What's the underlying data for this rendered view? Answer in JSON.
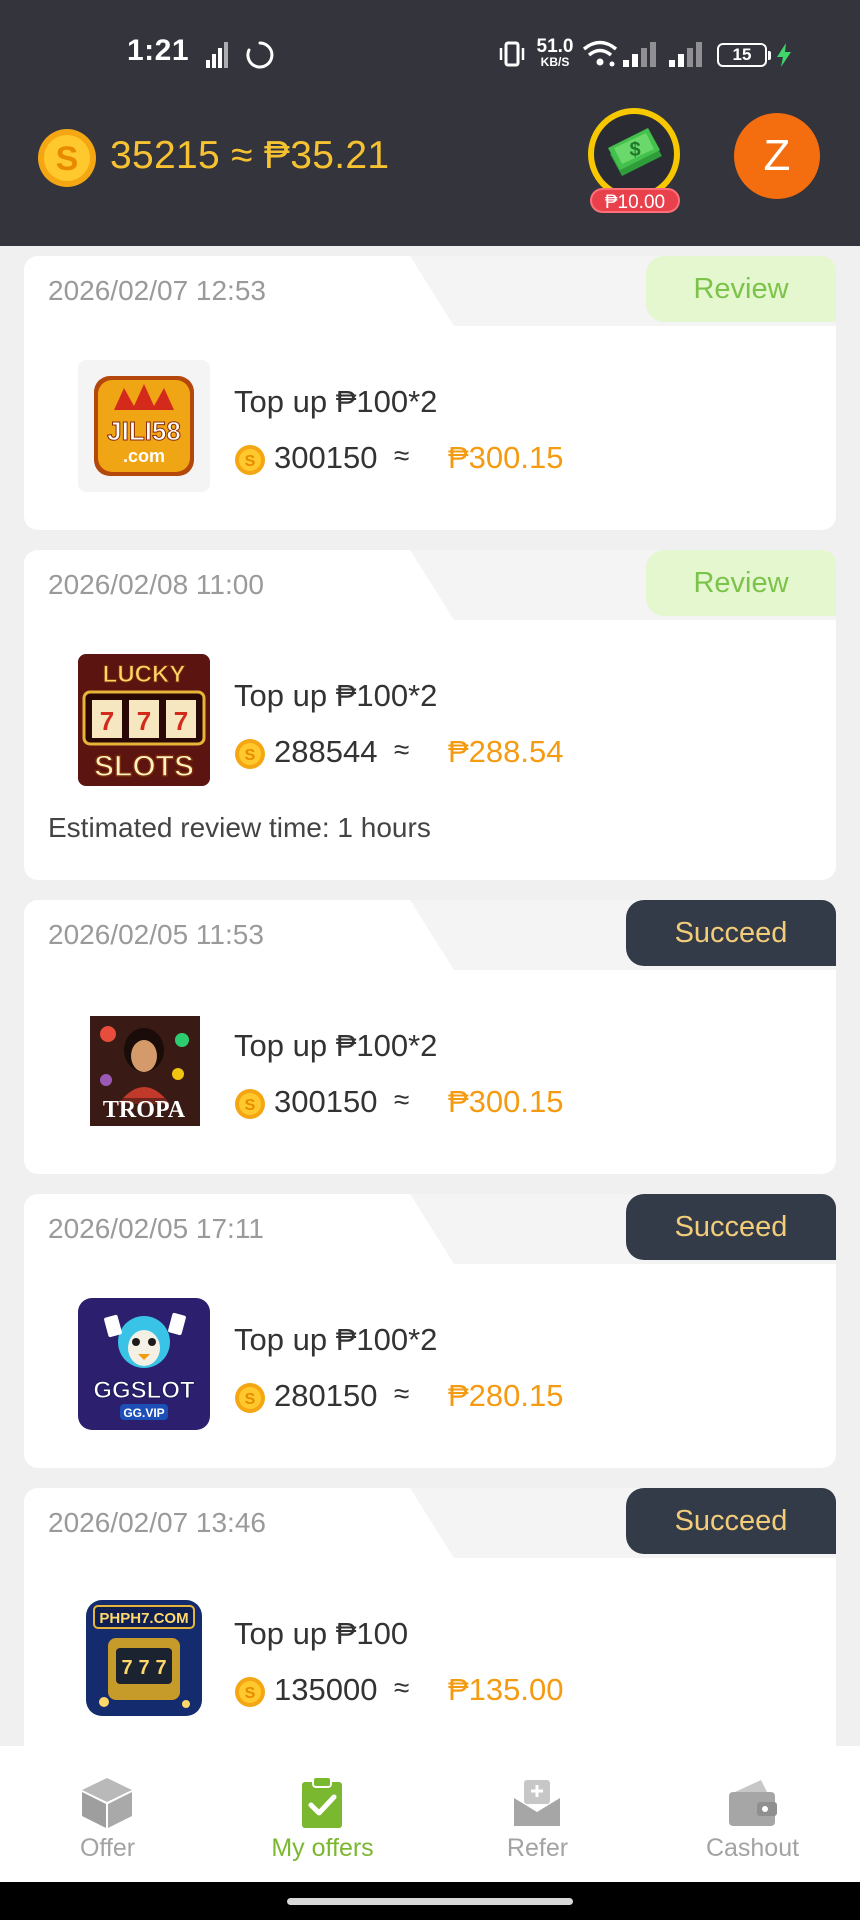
{
  "status_bar": {
    "time": "1:21",
    "net_speed_value": "51.0",
    "net_speed_unit": "KB/S",
    "battery_level": "15"
  },
  "header": {
    "balance_text": "35215 ≈ ₱35.21",
    "cash_bonus_label": "₱10.00",
    "avatar_letter": "Z"
  },
  "offers": [
    {
      "date": "2026/02/07 12:53",
      "status": "Review",
      "game": "JILI58.com",
      "title": "Top up ₱100*2",
      "coins": "300150",
      "approx": "≈",
      "peso": "₱300.15",
      "note": ""
    },
    {
      "date": "2026/02/08 11:00",
      "status": "Review",
      "game": "LUCKY SLOTS",
      "title": "Top up ₱100*2",
      "coins": "288544",
      "approx": "≈",
      "peso": "₱288.54",
      "note": "Estimated review time: 1 hours"
    },
    {
      "date": "2026/02/05 11:53",
      "status": "Succeed",
      "game": "TROPA",
      "title": "Top up ₱100*2",
      "coins": "300150",
      "approx": "≈",
      "peso": "₱300.15",
      "note": ""
    },
    {
      "date": "2026/02/05 17:11",
      "status": "Succeed",
      "game": "GGSLOT GG.VIP",
      "title": "Top up ₱100*2",
      "coins": "280150",
      "approx": "≈",
      "peso": "₱280.15",
      "note": ""
    },
    {
      "date": "2026/02/07 13:46",
      "status": "Succeed",
      "game": "PHPH7.COM",
      "title": "Top up ₱100",
      "coins": "135000",
      "approx": "≈",
      "peso": "₱135.00",
      "note": ""
    }
  ],
  "thumb_text": {
    "jili_line1": "JILI58",
    "jili_line2": ".com",
    "lucky_line1": "LUCKY",
    "lucky_line2": "SLOTS",
    "tropa": "TROPA",
    "ggslot_line1": "GGSLOT",
    "ggslot_line2": "GG.VIP",
    "phph7": "PHPH7.COM"
  },
  "bottom_nav": [
    {
      "label": "Offer",
      "icon": "box-icon",
      "active": false
    },
    {
      "label": "My offers",
      "icon": "clipboard-check-icon",
      "active": true
    },
    {
      "label": "Refer",
      "icon": "envelope-plus-icon",
      "active": false
    },
    {
      "label": "Cashout",
      "icon": "wallet-icon",
      "active": false
    }
  ],
  "colors": {
    "header_bg": "#33343c",
    "gold": "#f7c231",
    "review_bg": "#e4f7cf",
    "review_text": "#7cc34a",
    "succeed_bg": "#333b48",
    "succeed_text": "#f3cc7a",
    "peso_orange": "#f59b12",
    "nav_active": "#7ab82f"
  }
}
